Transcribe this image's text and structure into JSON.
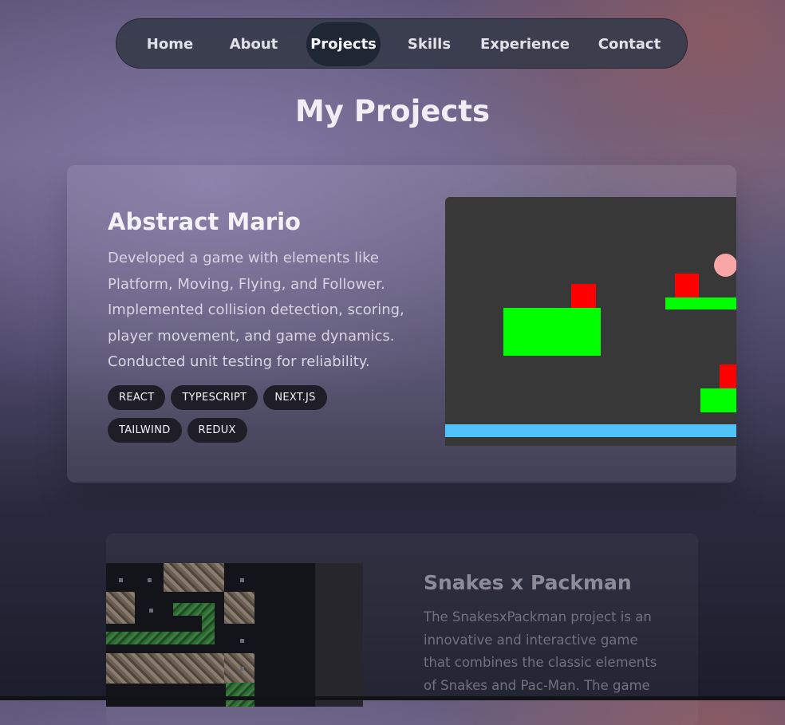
{
  "nav": {
    "items": [
      "Home",
      "About",
      "Projects",
      "Skills",
      "Experience",
      "Contact"
    ],
    "active": "Projects"
  },
  "heading": "My Projects",
  "projects": [
    {
      "title": "Abstract Mario",
      "description": "Developed a game with elements like Platform, Moving, Flying, and Follower. Implemented collision detection, scoring, player movement, and game dynamics. Conducted unit testing for reliability.",
      "tags": [
        "REACT",
        "TYPESCRIPT",
        "NEXT.JS",
        "TAILWIND",
        "REDUX"
      ]
    },
    {
      "title": "Snakes x Packman",
      "description": "The SnakesxPackman project is an innovative and interactive game that combines the classic elements of Snakes and Pac-Man. The game"
    }
  ],
  "colors": {
    "platform": "#00ff00",
    "enemy": "#ff0000",
    "floor": "#4fc3f7",
    "ball": "#f8a6a6",
    "tag_bg": "#1f1e26",
    "nav_active_bg": "#1e2733"
  }
}
